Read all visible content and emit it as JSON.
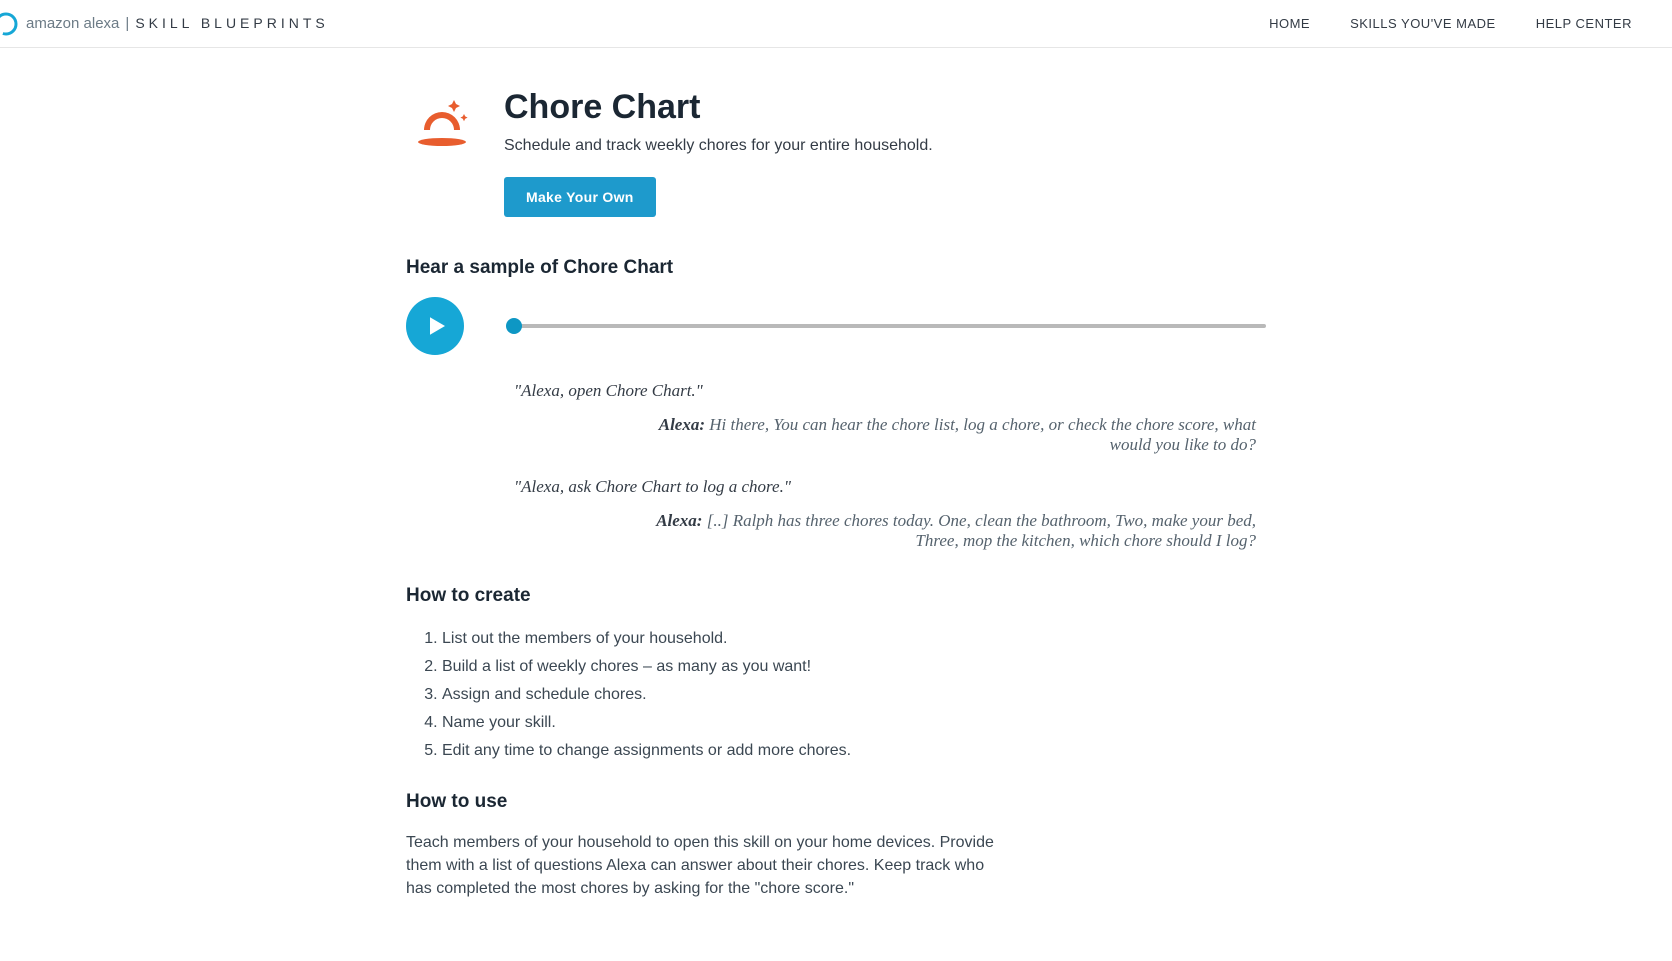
{
  "brand": {
    "alexa": "amazon alexa",
    "separator": "|",
    "blueprints": "SKILL BLUEPRINTS"
  },
  "nav": {
    "home": "HOME",
    "skills": "SKILLS YOU'VE MADE",
    "help": "HELP CENTER"
  },
  "hero": {
    "title": "Chore Chart",
    "desc": "Schedule and track weekly chores for your entire household.",
    "cta": "Make Your Own"
  },
  "sample": {
    "heading": "Hear a sample of Chore Chart",
    "transcript": {
      "user1": "\"Alexa, open Chore Chart.\"",
      "alexa_label": "Alexa:",
      "alexa1": " Hi there, You can hear the chore list, log a chore, or check the chore score, what would you like to do?",
      "user2": "\"Alexa, ask Chore Chart to log a chore.\"",
      "alexa2": " [..] Ralph has three chores today. One, clean the bathroom, Two, make your bed, Three, mop the kitchen, which chore should I log?"
    }
  },
  "create": {
    "heading": "How to create",
    "steps": [
      "List out the members of your household.",
      "Build a list of weekly chores – as many as you want!",
      "Assign and schedule chores.",
      "Name your skill.",
      "Edit any time to change assignments or add more chores."
    ]
  },
  "use": {
    "heading": "How to use",
    "text": "Teach members of your household to open this skill on your home devices. Provide them with a list of questions Alexa can answer about their chores. Keep track who has completed the most chores by asking for the \"chore score.\""
  }
}
